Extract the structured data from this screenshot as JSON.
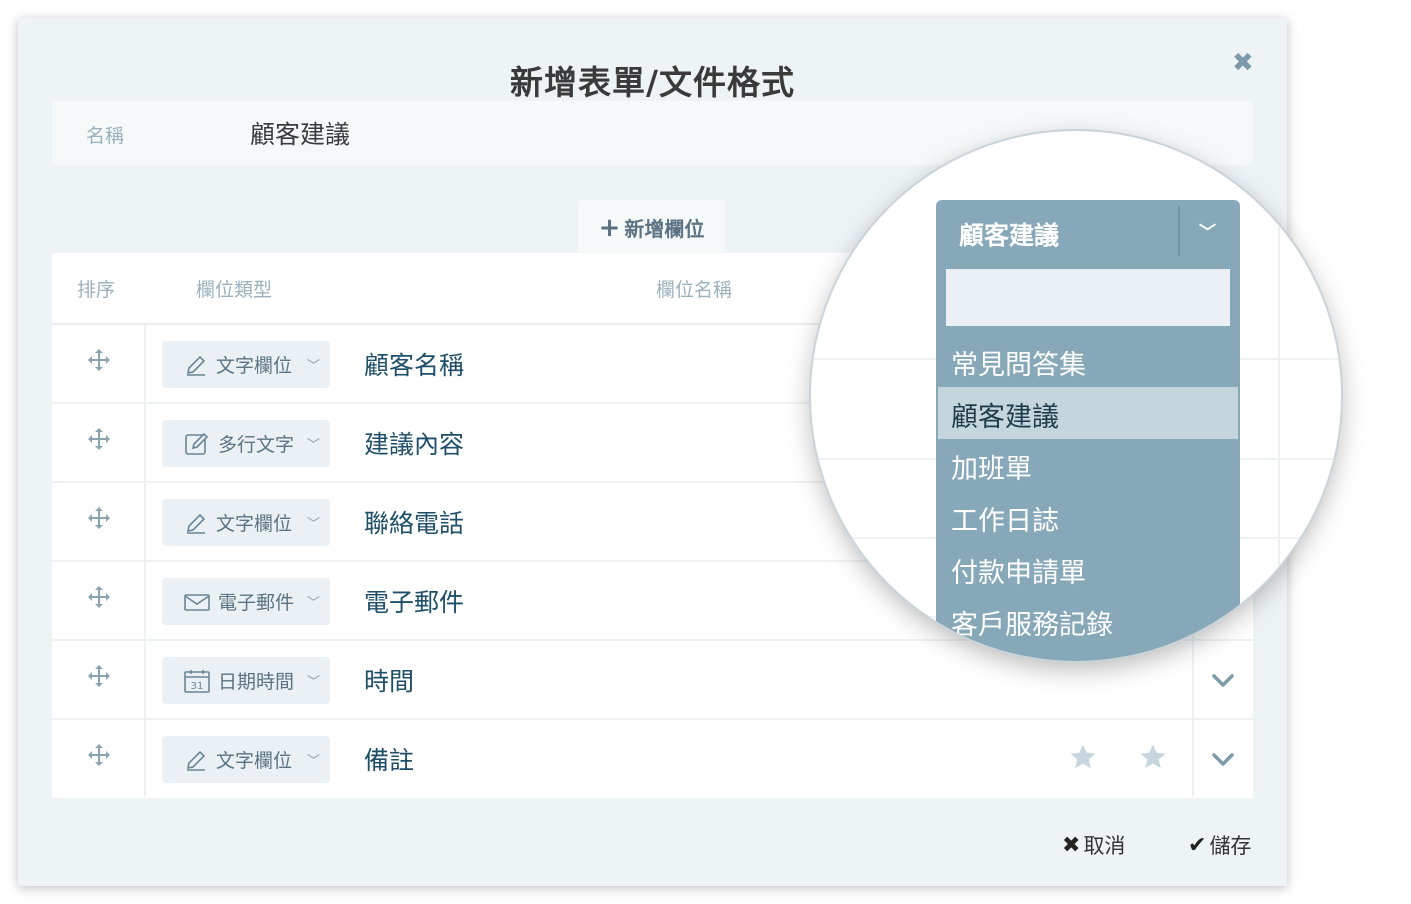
{
  "dialog": {
    "title": "新增表單/文件格式",
    "close_icon": "close-icon",
    "name_label": "名稱",
    "name_value": "顧客建議",
    "add_field_label": "新增欄位"
  },
  "table": {
    "headers": {
      "order": "排序",
      "field_type": "欄位類型",
      "field_name": "欄位名稱"
    },
    "rows": [
      {
        "type_icon": "pencil-icon",
        "type_label": "文字欄位",
        "name": "顧客名稱"
      },
      {
        "type_icon": "edit-box-icon",
        "type_label": "多行文字",
        "name": "建議內容"
      },
      {
        "type_icon": "pencil-icon",
        "type_label": "文字欄位",
        "name": "聯絡電話"
      },
      {
        "type_icon": "envelope-icon",
        "type_label": "電子郵件",
        "name": "電子郵件"
      },
      {
        "type_icon": "calendar-icon",
        "type_label": "日期時間",
        "name": "時間",
        "calendar_day": "31"
      },
      {
        "type_icon": "pencil-icon",
        "type_label": "文字欄位",
        "name": "備註"
      }
    ]
  },
  "footer": {
    "cancel_label": "取消",
    "save_label": "儲存"
  },
  "dropdown": {
    "selected": "顧客建議",
    "search_value": "",
    "options": [
      "常見問答集",
      "顧客建議",
      "加班單",
      "工作日誌",
      "付款申請單",
      "客戶服務記錄"
    ],
    "highlighted_index": 1
  },
  "colors": {
    "accent": "#87a8b8",
    "field_name_text": "#1f4f68",
    "panel_bg": "#eef3f6"
  }
}
